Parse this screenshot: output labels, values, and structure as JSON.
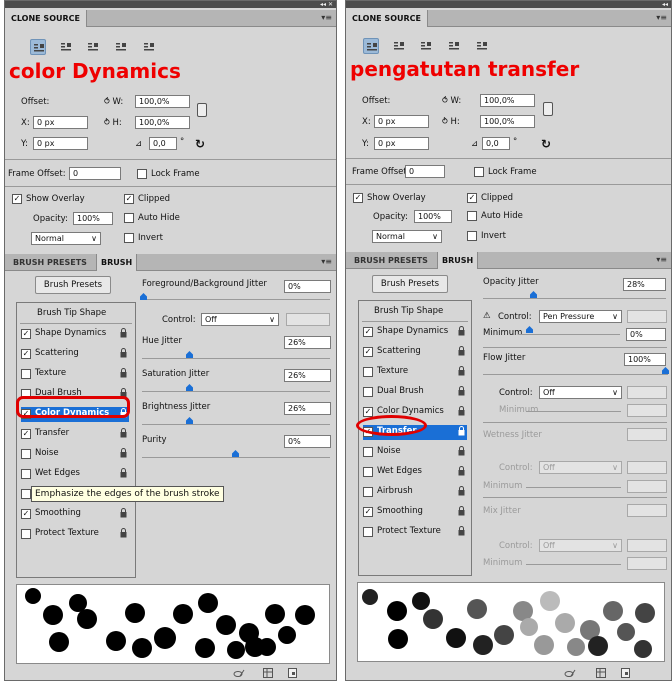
{
  "left": {
    "panel_title": "CLONE SOURCE",
    "big_label": "color Dynamics",
    "offset_label": "Offset:",
    "w_label": "W:",
    "w_value": "100,0%",
    "h_label": "H:",
    "h_value": "100,0%",
    "x_label": "X:",
    "x_value": "0 px",
    "y_label": "Y:",
    "y_value": "0 px",
    "angle_value": "0,0",
    "degree": "°",
    "frame_offset_label": "Frame Offset:",
    "frame_offset_value": "0",
    "lock_frame": "Lock Frame",
    "show_overlay": "Show Overlay",
    "clipped": "Clipped",
    "opacity_label": "Opacity:",
    "opacity_value": "100%",
    "auto_hide": "Auto Hide",
    "blend_mode": "Normal",
    "invert": "Invert",
    "tab_presets": "BRUSH PRESETS",
    "tab_brush": "BRUSH",
    "brush_presets_btn": "Brush Presets",
    "brush_tip_shape": "Brush Tip Shape",
    "items": [
      {
        "label": "Shape Dynamics",
        "checked": true
      },
      {
        "label": "Scattering",
        "checked": true
      },
      {
        "label": "Texture",
        "checked": false
      },
      {
        "label": "Dual Brush",
        "checked": false
      },
      {
        "label": "Color Dynamics",
        "checked": true
      },
      {
        "label": "Transfer",
        "checked": true
      },
      {
        "label": "Noise",
        "checked": false
      },
      {
        "label": "Wet Edges",
        "checked": false
      },
      {
        "label": "Airbrush",
        "checked": false
      },
      {
        "label": "Smoothing",
        "checked": true
      },
      {
        "label": "Protect Texture",
        "checked": false
      }
    ],
    "fg_bg_jitter": "Foreground/Background Jitter",
    "fg_bg_value": "0%",
    "control_label": "Control:",
    "control_value": "Off",
    "hue_jitter": "Hue Jitter",
    "hue_value": "26%",
    "sat_jitter": "Saturation Jitter",
    "sat_value": "26%",
    "bright_jitter": "Brightness Jitter",
    "bright_value": "26%",
    "purity": "Purity",
    "purity_value": "0%",
    "tooltip": "Emphasize the edges of the brush stroke"
  },
  "right": {
    "panel_title": "CLONE SOURCE",
    "big_label": "pengatutan transfer",
    "offset_label": "Offset:",
    "w_label": "W:",
    "w_value": "100,0%",
    "h_label": "H:",
    "h_value": "100,0%",
    "x_label": "X:",
    "x_value": "0 px",
    "y_label": "Y:",
    "y_value": "0 px",
    "angle_value": "0,0",
    "degree": "°",
    "frame_offset_label": "Frame Offset:",
    "frame_offset_value": "0",
    "lock_frame": "Lock Frame",
    "show_overlay": "Show Overlay",
    "clipped": "Clipped",
    "opacity_label": "Opacity:",
    "opacity_value": "100%",
    "auto_hide": "Auto Hide",
    "blend_mode": "Normal",
    "invert": "Invert",
    "tab_presets": "BRUSH PRESETS",
    "tab_brush": "BRUSH",
    "brush_presets_btn": "Brush Presets",
    "brush_tip_shape": "Brush Tip Shape",
    "items": [
      {
        "label": "Shape Dynamics",
        "checked": true
      },
      {
        "label": "Scattering",
        "checked": true
      },
      {
        "label": "Texture",
        "checked": false
      },
      {
        "label": "Dual Brush",
        "checked": false
      },
      {
        "label": "Color Dynamics",
        "checked": true
      },
      {
        "label": "Transfer",
        "checked": true
      },
      {
        "label": "Noise",
        "checked": false
      },
      {
        "label": "Wet Edges",
        "checked": false
      },
      {
        "label": "Airbrush",
        "checked": false
      },
      {
        "label": "Smoothing",
        "checked": true
      },
      {
        "label": "Protect Texture",
        "checked": false
      }
    ],
    "opacity_jitter": "Opacity Jitter",
    "opacity_jitter_value": "28%",
    "control_label": "Control:",
    "control_value": "Pen Pressure",
    "minimum_label": "Minimum",
    "minimum_value": "0%",
    "flow_jitter": "Flow Jitter",
    "flow_value": "100%",
    "control2_value": "Off",
    "minimum2_label": "Minimum",
    "wetness_jitter": "Wetness Jitter",
    "control3_value": "Off",
    "minimum3_label": "Minimum",
    "mix_jitter": "Mix Jitter",
    "control4_value": "Off",
    "minimum4_label": "Minimum"
  },
  "colors": {
    "accent": "#1a6fd6",
    "annotation": "#ef0000",
    "panel": "#d6d6d6",
    "tab_bar": "#b5b5b5"
  },
  "icons": [
    "clone-source-icon",
    "link-icon",
    "reset-icon",
    "lock-icon",
    "warning-icon",
    "new-brush-icon",
    "trash-icon"
  ]
}
